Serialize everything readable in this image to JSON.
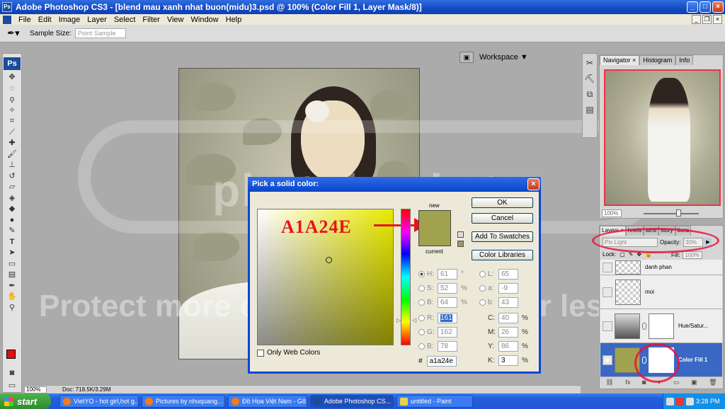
{
  "window": {
    "title": "Adobe Photoshop CS3 - [blend mau xanh nhat buon(midu)3.psd @ 100% (Color Fill 1, Layer Mask/8)]",
    "app_icon": "Ps"
  },
  "menu": [
    "File",
    "Edit",
    "Image",
    "Layer",
    "Select",
    "Filter",
    "View",
    "Window",
    "Help"
  ],
  "options_bar": {
    "sample_size_label": "Sample Size:",
    "sample_size_value": "Point Sample",
    "workspace_label": "Workspace ▼"
  },
  "tools_panel": {
    "logo": "Ps"
  },
  "watermark": {
    "brand": "photobucket",
    "tagline": "Protect more of your memories for less!"
  },
  "color_picker": {
    "title": "Pick a solid color:",
    "annotation": "A1A24E",
    "new_label": "new",
    "current_label": "current",
    "new_color": "#a1a24e",
    "buttons": {
      "ok": "OK",
      "cancel": "Cancel",
      "add_swatches": "Add To Swatches",
      "color_libraries": "Color Libraries"
    },
    "hsb": [
      {
        "key": "H:",
        "value": "61",
        "unit": "°"
      },
      {
        "key": "S:",
        "value": "52",
        "unit": "%"
      },
      {
        "key": "B:",
        "value": "64",
        "unit": "%"
      }
    ],
    "rgb": [
      {
        "key": "R:",
        "value": "161"
      },
      {
        "key": "G:",
        "value": "162"
      },
      {
        "key": "B:",
        "value": "78"
      }
    ],
    "lab": [
      {
        "key": "L:",
        "value": "65"
      },
      {
        "key": "a:",
        "value": "-9"
      },
      {
        "key": "b:",
        "value": "43"
      }
    ],
    "cmyk": [
      {
        "key": "C:",
        "value": "40",
        "unit": "%"
      },
      {
        "key": "M:",
        "value": "26",
        "unit": "%"
      },
      {
        "key": "Y:",
        "value": "86",
        "unit": "%"
      },
      {
        "key": "K:",
        "value": "3",
        "unit": "%"
      }
    ],
    "only_web_colors": "Only Web Colors",
    "hex_label": "#",
    "hex_value": "a1a24e"
  },
  "navigator": {
    "tabs": [
      "Navigator ×",
      "Histogram",
      "Info"
    ],
    "zoom": "100%"
  },
  "layers": {
    "tabs": [
      "Layers ×",
      "hnels",
      "aths",
      "story",
      "tions"
    ],
    "blend_mode": "Pin Light",
    "opacity_label": "Opacity:",
    "opacity": "30%",
    "lock_label": "Lock:",
    "fill_label": "Fill:",
    "fill": "100%",
    "items": [
      {
        "name": "danh phan"
      },
      {
        "name": "moi"
      },
      {
        "name": "Hue/Satur..."
      },
      {
        "name": "Color Fill 1"
      }
    ],
    "fill_swatch": "#a1a24e"
  },
  "status": {
    "zoom": "100%",
    "doc": "Doc: 718.5K/3.29M"
  },
  "taskbar": {
    "start": "start",
    "tasks": [
      "VietYO - hot girl,hot g...",
      "Pictures by nhuquang...",
      "Đồ Họa Việt Nam - Gõ...",
      "Adobe Photoshop CS...",
      "untitled - Paint"
    ],
    "clock": "3:28 PM"
  }
}
